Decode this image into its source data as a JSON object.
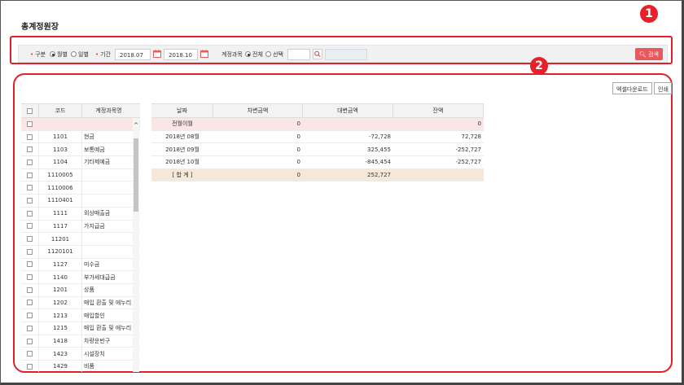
{
  "page": {
    "title": "총계정원장"
  },
  "filter": {
    "type_label": "구분",
    "type_options": [
      "월별",
      "일별"
    ],
    "period_label": "기간",
    "date_from": "2018.07",
    "date_to": "2018.10",
    "account_label": "계정과목",
    "account_options": [
      "전체",
      "선택"
    ],
    "search_button": "검색"
  },
  "badges": [
    "1",
    "2"
  ],
  "toolbar": {
    "excel_download": "엑셀다운로드",
    "print": "인쇄"
  },
  "account_table": {
    "headers": [
      "코드",
      "계정과목명"
    ],
    "rows": [
      {
        "code": "",
        "name": ""
      },
      {
        "code": "1101",
        "name": "현금"
      },
      {
        "code": "1103",
        "name": "보통예금"
      },
      {
        "code": "1104",
        "name": "기타제예금"
      },
      {
        "code": "1110005",
        "name": ""
      },
      {
        "code": "1110006",
        "name": ""
      },
      {
        "code": "1110401",
        "name": ""
      },
      {
        "code": "1111",
        "name": "외상매출금"
      },
      {
        "code": "1117",
        "name": "가지급금"
      },
      {
        "code": "11201",
        "name": ""
      },
      {
        "code": "1120101",
        "name": ""
      },
      {
        "code": "1127",
        "name": "미수금"
      },
      {
        "code": "1140",
        "name": "부가세대급금"
      },
      {
        "code": "1201",
        "name": "상품"
      },
      {
        "code": "1202",
        "name": "매입 환출 및 에누리"
      },
      {
        "code": "1213",
        "name": "매입할인"
      },
      {
        "code": "1215",
        "name": "매입 환출 및 에누리"
      },
      {
        "code": "1418",
        "name": "차량운반구"
      },
      {
        "code": "1423",
        "name": "시설장치"
      },
      {
        "code": "1429",
        "name": "비품"
      }
    ]
  },
  "ledger_table": {
    "headers": [
      "날짜",
      "차변금액",
      "대변금액",
      "잔액"
    ],
    "rows": [
      {
        "date": "전월이월",
        "debit": "0",
        "credit": "",
        "balance": "0",
        "style": "pink"
      },
      {
        "date": "2018년 08월",
        "debit": "0",
        "credit": "-72,728",
        "balance": "72,728",
        "style": ""
      },
      {
        "date": "2018년 09월",
        "debit": "0",
        "credit": "325,455",
        "balance": "-252,727",
        "style": ""
      },
      {
        "date": "2018년 10월",
        "debit": "0",
        "credit": "-845,454",
        "balance": "-252,727",
        "style": ""
      },
      {
        "date": "[ 합 계 ]",
        "debit": "0",
        "credit": "252,727",
        "balance": "",
        "style": "beige"
      }
    ]
  },
  "colors": {
    "accent_red": "#e0202a",
    "search_button": "#e8585f",
    "carryover_row": "#fbe6e6",
    "total_row": "#f6e8d8"
  }
}
